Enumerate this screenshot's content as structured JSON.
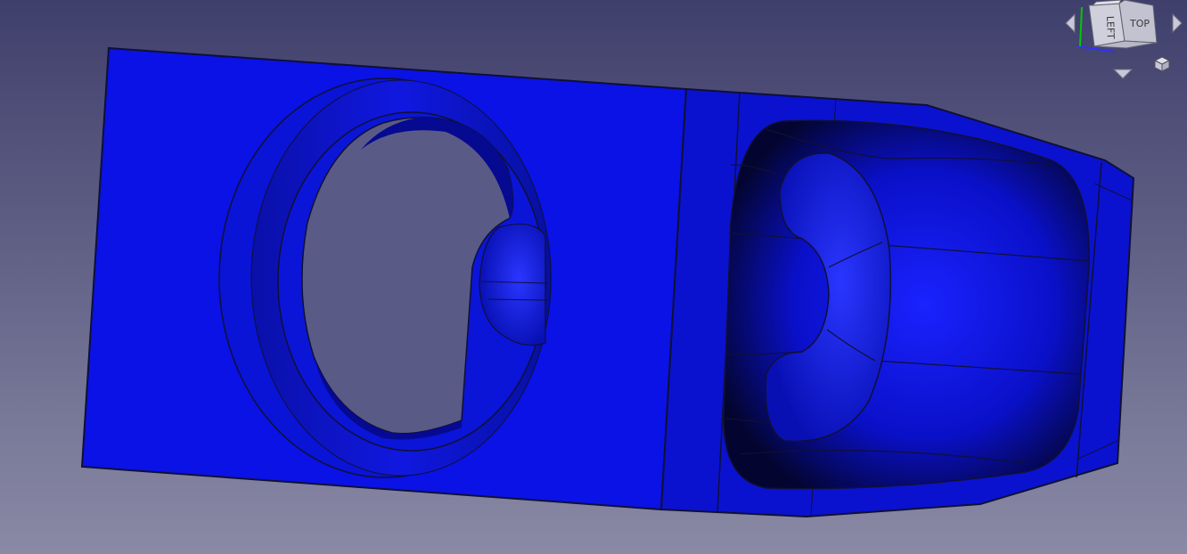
{
  "viewport": {
    "background_top": "#3f3f6c",
    "background_bottom": "#8a8aa6"
  },
  "model": {
    "face_color": "#0a12e6",
    "edge_color": "#101035",
    "shadow_color": "#050a50"
  },
  "nav_cube": {
    "left_label": "LEFT",
    "top_label": "TOP",
    "axis_x_color": "#3030ff",
    "axis_y_color": "#00c800"
  }
}
